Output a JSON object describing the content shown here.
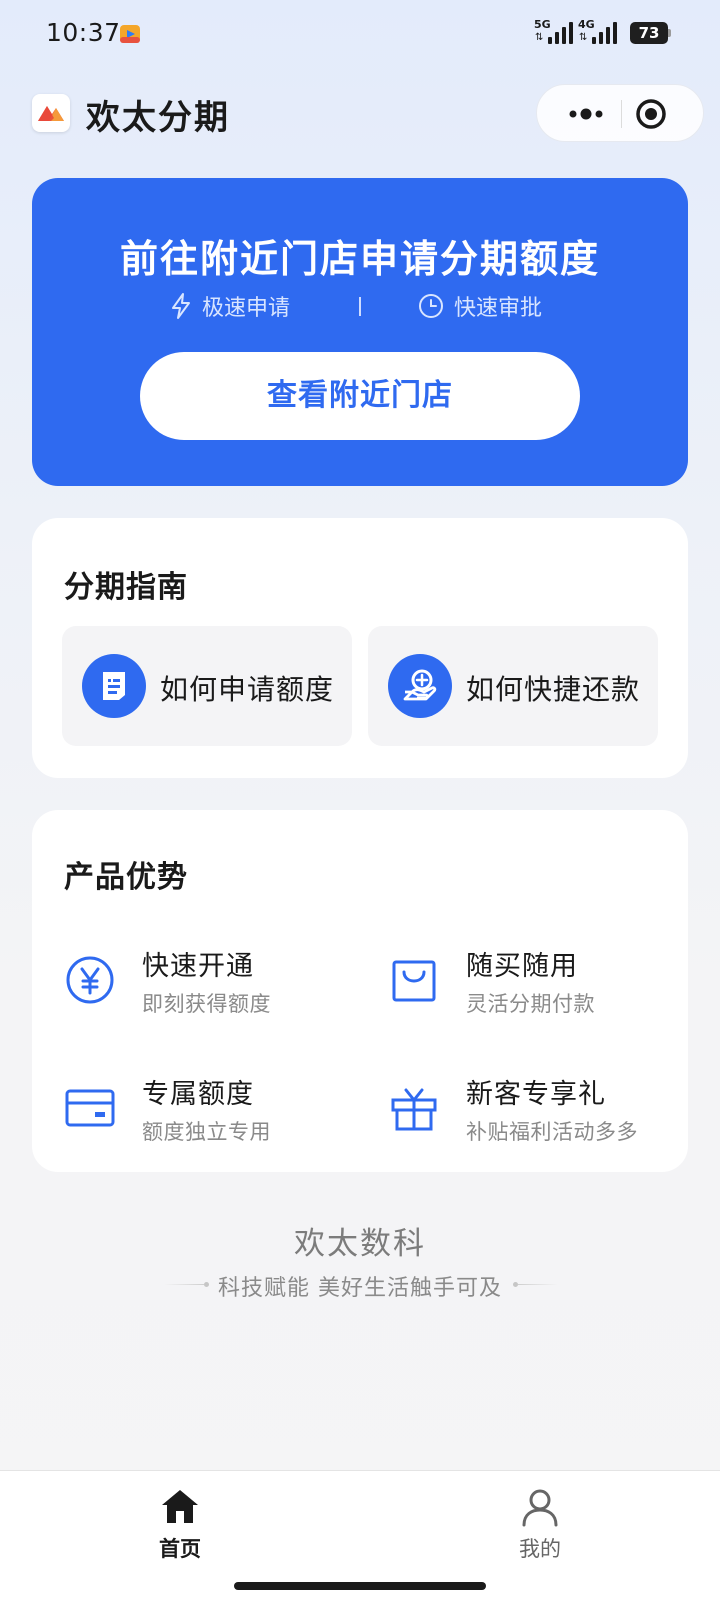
{
  "status_bar": {
    "time": "10:37",
    "signal_1_label": "5G",
    "signal_2_label": "4G",
    "battery": "73",
    "app_icon": "media-app-icon"
  },
  "header": {
    "app_title": "欢太分期",
    "logo_icon": "brand-logo-icon",
    "more_icon": "more-dots-icon",
    "close_icon": "target-close-icon"
  },
  "banner": {
    "title": "前往附近门店申请分期额度",
    "features": [
      {
        "label": "极速申请",
        "icon": "lightning-icon"
      },
      {
        "label": "快速审批",
        "icon": "clock-icon"
      }
    ],
    "button_label": "查看附近门店",
    "background_color": "#2f6af0"
  },
  "guide": {
    "title": "分期指南",
    "items": [
      {
        "label": "如何申请额度",
        "icon": "document-icon"
      },
      {
        "label": "如何快捷还款",
        "icon": "hand-coin-icon"
      }
    ]
  },
  "advantages": {
    "title": "产品优势",
    "items": [
      {
        "name": "快速开通",
        "desc": "即刻获得额度",
        "icon": "yen-circle-icon"
      },
      {
        "name": "随买随用",
        "desc": "灵活分期付款",
        "icon": "shopping-bag-icon"
      },
      {
        "name": "专属额度",
        "desc": "额度独立专用",
        "icon": "card-icon"
      },
      {
        "name": "新客专享礼",
        "desc": "补贴福利活动多多",
        "icon": "gift-icon"
      }
    ]
  },
  "brand": {
    "name": "欢太数科",
    "slogan": "科技赋能 美好生活触手可及"
  },
  "tab_bar": {
    "tabs": [
      {
        "label": "首页",
        "icon": "home-icon",
        "active": true
      },
      {
        "label": "我的",
        "icon": "user-icon",
        "active": false
      }
    ]
  },
  "colors": {
    "accent": "#2f6af0",
    "text_primary": "#1a1a1a",
    "text_secondary": "#8a8a8a"
  }
}
